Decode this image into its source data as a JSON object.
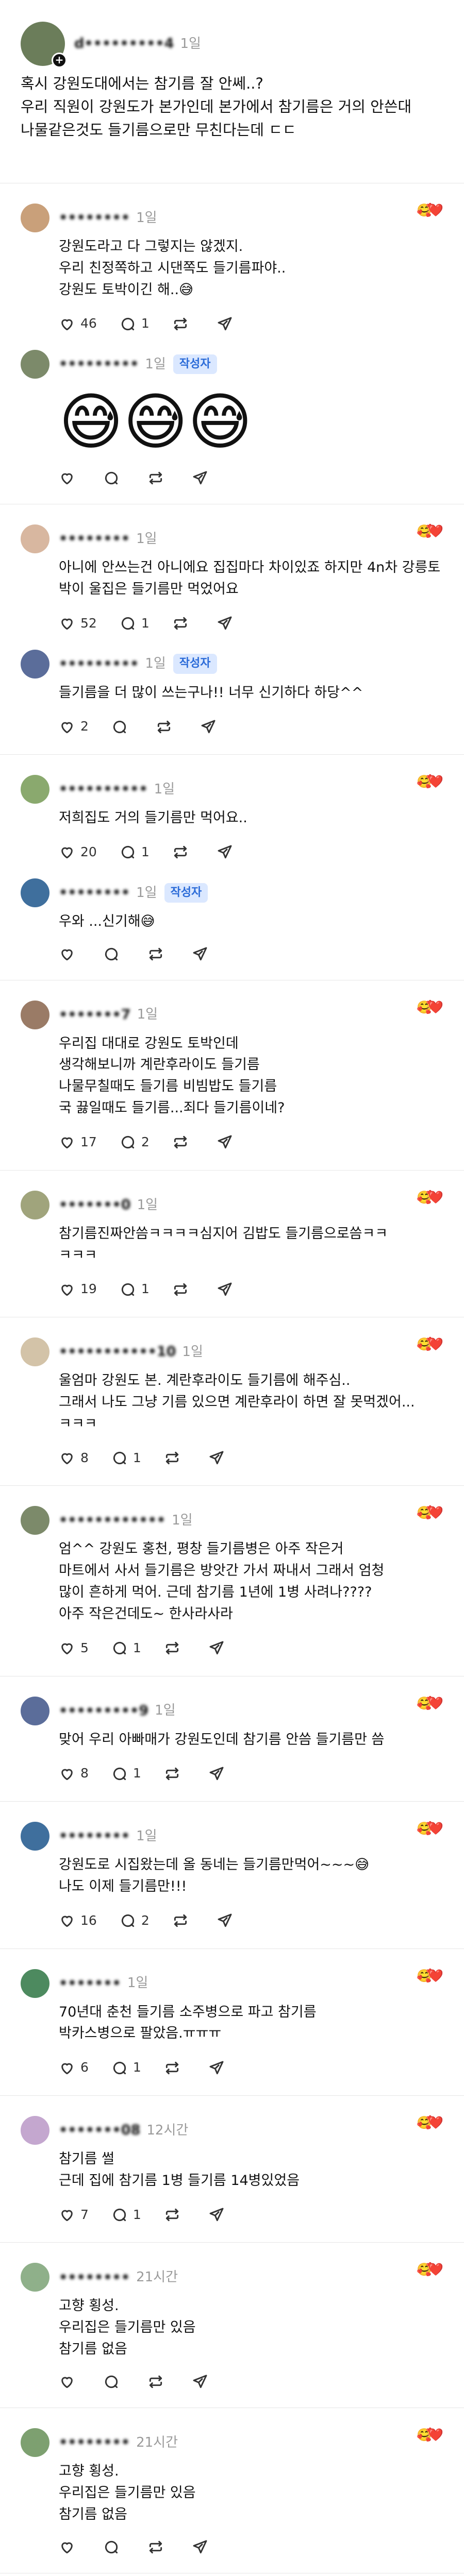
{
  "colors": {
    "accent": "#2b6bd8",
    "heart": "#e0245e",
    "muted": "#9a9a9a"
  },
  "icons": [
    "heart-icon",
    "comment-icon",
    "repost-icon",
    "share-icon",
    "plus-icon",
    "laugh-react-icon"
  ],
  "main_post": {
    "username": "d•••••••••4",
    "time": "1일",
    "body": "혹시 강원도대에서는 참기름 잘 안쎄..?\n우리 직원이 강원도가 본가인데 본가에서 참기름은 거의 안쓴대\n나물같은것도 들기름으로만 무친다는데 ㄷㄷ"
  },
  "comments": [
    {
      "username": "••••••••",
      "time": "1일",
      "body": "강원도라고 다 그렇지는 않겠지.\n우리 친정쪽하고 시댄쪽도 들기름파야..\n강원도 토박이긴 해..😅",
      "likes": "46",
      "replies": "1",
      "reply": {
        "username": "•••••••••",
        "time": "1일",
        "badge": "작성자",
        "body": "",
        "emojis": "😅😅😅"
      }
    },
    {
      "username": "••••••••",
      "time": "1일",
      "body": "아니에 안쓰는건 아니에요 집집마다 차이있죠 하지만 4n차 강릉토박이 울집은 들기름만 먹었어요",
      "likes": "52",
      "replies": "1",
      "reply": {
        "username": "•••••••••",
        "time": "1일",
        "badge": "작성자",
        "body": "들기름을 더 많이 쓰는구나!! 너무 신기하다 하당^^",
        "likes": "2",
        "replies": "",
        "emojis": ""
      }
    },
    {
      "username": "••••••••••",
      "time": "1일",
      "body": "저희집도 거의 들기름만 먹어요..",
      "likes": "20",
      "replies": "1",
      "reply": {
        "username": "••••••••",
        "time": "1일",
        "badge": "작성자",
        "body": "우와 ...신기해😅",
        "likes": "",
        "replies": "",
        "emojis": ""
      }
    },
    {
      "username": "•••••••7",
      "time": "1일",
      "body": "우리집 대대로 강원도 토박인데\n생각해보니까 계란후라이도 들기름\n나물무칠때도 들기름 비빔밥도 들기름\n국 끓일때도 들기름...죄다 들기름이네?",
      "likes": "17",
      "replies": "2"
    },
    {
      "username": "•••••••0",
      "time": "1일",
      "body": "참기름진짜안씀ㅋㅋㅋㅋ심지어 김밥도 들기름으로씀ㅋㅋ\nㅋㅋㅋ",
      "likes": "19",
      "replies": "1"
    },
    {
      "username": "•••••••••••10",
      "time": "1일",
      "body": "울엄마 강원도 본. 계란후라이도 들기름에 해주심..\n그래서 나도 그냥 기름 있으면 계란후라이 하면 잘 못먹겠어...\nㅋㅋㅋ",
      "likes": "8",
      "replies": "1"
    },
    {
      "username": "••••••••••••",
      "time": "1일",
      "body": "엄^^ 강원도 홍천, 평창 들기름병은 아주 작은거\n마트에서 사서 들기름은 방앗간 가서 짜내서 그래서 엄청\n많이 흔하게 먹어. 근데 참기름 1년에 1병 사려나????\n아주 작은건데도~ 한사라사라",
      "likes": "5",
      "replies": "1"
    },
    {
      "username": "•••••••••9",
      "time": "1일",
      "body": "맞어 우리 아빠매가 강원도인데 참기름 안씀 들기름만 씀",
      "likes": "8",
      "replies": "1"
    },
    {
      "username": "••••••••",
      "time": "1일",
      "body": "강원도로 시집왔는데 올 동네는 들기름만먹어~~~😅\n나도 이제 들기름만!!!",
      "likes": "16",
      "replies": "2"
    },
    {
      "username": "•••••••",
      "time": "1일",
      "body": "70년대 춘천 들기름 소주병으로 파고 참기름\n박카스병으로 팔았음.ㅠㅠㅠ",
      "likes": "6",
      "replies": "1"
    },
    {
      "username": "•••••••08",
      "time": "12시간",
      "body": "참기름 썰\n근데 집에 참기름 1병 들기름 14병있었음",
      "likes": "7",
      "replies": "1"
    },
    {
      "username": "••••••••",
      "time": "21시간",
      "body": "고향 횡성.\n우리집은 들기름만 있음\n참기름 없음",
      "likes": "",
      "replies": ""
    },
    {
      "username": "••••••••",
      "time": "21시간",
      "body": "고향 횡성.\n우리집은 들기름만 있음\n참기름 없음",
      "likes": "",
      "replies": ""
    }
  ]
}
